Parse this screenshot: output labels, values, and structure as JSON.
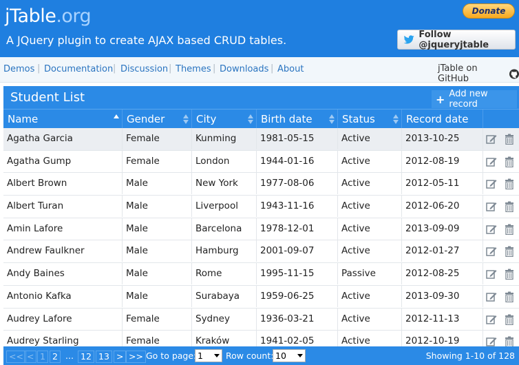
{
  "header": {
    "logo_main": "jTable",
    "logo_ext": ".org",
    "tagline": "A JQuery plugin to create AJAX based CRUD tables.",
    "donate_label": "Donate",
    "follow_label": "Follow @jqueryjtable"
  },
  "nav": {
    "items": [
      "Demos",
      "Documentation",
      "Discussion",
      "Themes",
      "Downloads",
      "About"
    ],
    "github_label": "jTable on GitHub"
  },
  "table": {
    "title": "Student List",
    "add_label": "Add new record",
    "columns": [
      "Name",
      "Gender",
      "City",
      "Birth date",
      "Status",
      "Record date"
    ],
    "sorted_column": "Name",
    "rows": [
      [
        "Agatha Garcia",
        "Female",
        "Kunming",
        "1981-05-15",
        "Active",
        "2013-10-25"
      ],
      [
        "Agatha Gump",
        "Female",
        "London",
        "1944-01-16",
        "Active",
        "2012-08-19"
      ],
      [
        "Albert Brown",
        "Male",
        "New York",
        "1977-08-06",
        "Active",
        "2012-05-11"
      ],
      [
        "Albert Turan",
        "Male",
        "Liverpool",
        "1943-11-16",
        "Active",
        "2012-06-20"
      ],
      [
        "Amin Lafore",
        "Male",
        "Barcelona",
        "1978-12-01",
        "Active",
        "2013-09-09"
      ],
      [
        "Andrew Faulkner",
        "Male",
        "Hamburg",
        "2001-09-07",
        "Active",
        "2012-01-27"
      ],
      [
        "Andy Baines",
        "Male",
        "Rome",
        "1995-11-15",
        "Passive",
        "2012-08-25"
      ],
      [
        "Antonio Kafka",
        "Male",
        "Surabaya",
        "1959-06-25",
        "Active",
        "2013-09-30"
      ],
      [
        "Audrey Lafore",
        "Female",
        "Sydney",
        "1936-03-21",
        "Active",
        "2012-11-13"
      ],
      [
        "Audrey Starling",
        "Female",
        "Kraków",
        "1941-02-05",
        "Active",
        "2012-10-19"
      ]
    ]
  },
  "pager": {
    "first": "<<",
    "prev": "<",
    "pages": [
      "1",
      "2",
      "...",
      "12",
      "13"
    ],
    "next": ">",
    "last": ">>",
    "goto_label": "Go to page:",
    "goto_value": "1",
    "rowcount_label": "Row count:",
    "rowcount_value": "10",
    "showing": "Showing 1-10 of 128"
  },
  "colors": {
    "accent": "#2b8ae6",
    "header": "#1f7fe0",
    "link": "#2a74c0"
  }
}
